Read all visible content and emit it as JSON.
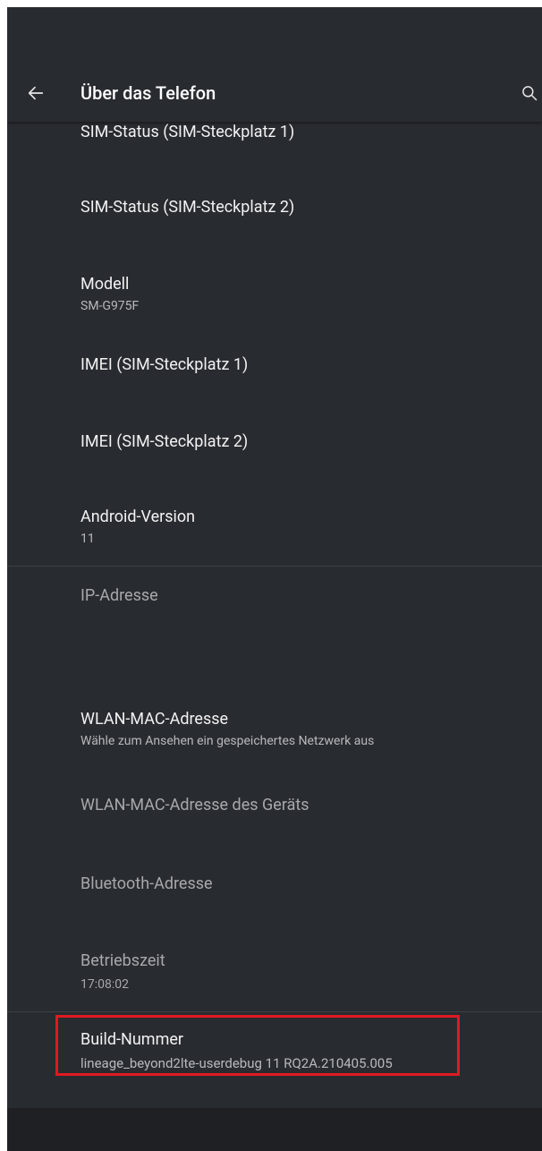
{
  "header": {
    "title": "Über das Telefon",
    "back_icon": "arrow-left-icon",
    "search_icon": "search-icon"
  },
  "items": [
    {
      "title": "SIM-Status (SIM-Steckplatz 1)",
      "summary": ""
    },
    {
      "title": "SIM-Status (SIM-Steckplatz 2)",
      "summary": ""
    },
    {
      "title": "Modell",
      "summary": "SM-G975F"
    },
    {
      "title": "IMEI (SIM-Steckplatz 1)",
      "summary": ""
    },
    {
      "title": "IMEI (SIM-Steckplatz 2)",
      "summary": ""
    },
    {
      "title": "Android-Version",
      "summary": "11"
    },
    {
      "title": "IP-Adresse",
      "summary": ""
    },
    {
      "title": "WLAN-MAC-Adresse",
      "summary": "Wähle zum Ansehen ein gespeichertes Netzwerk aus"
    },
    {
      "title": "WLAN-MAC-Adresse des Geräts",
      "summary": ""
    },
    {
      "title": "Bluetooth-Adresse",
      "summary": ""
    },
    {
      "title": "Betriebszeit",
      "summary": "17:08:02"
    },
    {
      "title": "Build-Nummer",
      "summary": "lineage_beyond2lte-userdebug 11 RQ2A.210405.005"
    }
  ],
  "colors": {
    "background": "#282b30",
    "highlight": "#e01a22",
    "text_primary": "#f2f2f2",
    "text_secondary": "#b8b9bc"
  }
}
